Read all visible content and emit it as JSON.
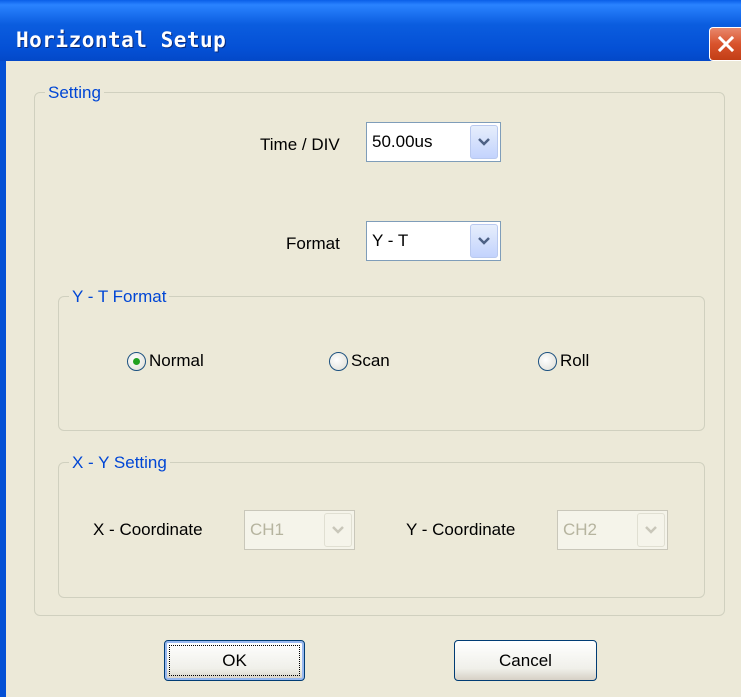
{
  "window": {
    "title": "Horizontal Setup"
  },
  "setting": {
    "group_label": "Setting",
    "time_div": {
      "label": "Time / DIV",
      "value": "50.00us"
    },
    "format": {
      "label": "Format",
      "value": "Y - T"
    }
  },
  "yt_format": {
    "group_label": "Y - T Format",
    "options": [
      {
        "label": "Normal",
        "selected": true
      },
      {
        "label": "Scan",
        "selected": false
      },
      {
        "label": "Roll",
        "selected": false
      }
    ]
  },
  "xy_setting": {
    "group_label": "X - Y Setting",
    "x_coordinate": {
      "label": "X - Coordinate",
      "value": "CH1"
    },
    "y_coordinate": {
      "label": "Y - Coordinate",
      "value": "CH2"
    }
  },
  "buttons": {
    "ok": "OK",
    "cancel": "Cancel"
  },
  "colors": {
    "title_bar": "#0450d5",
    "group_title": "#0046d5",
    "radio_selected": "#21a121"
  }
}
